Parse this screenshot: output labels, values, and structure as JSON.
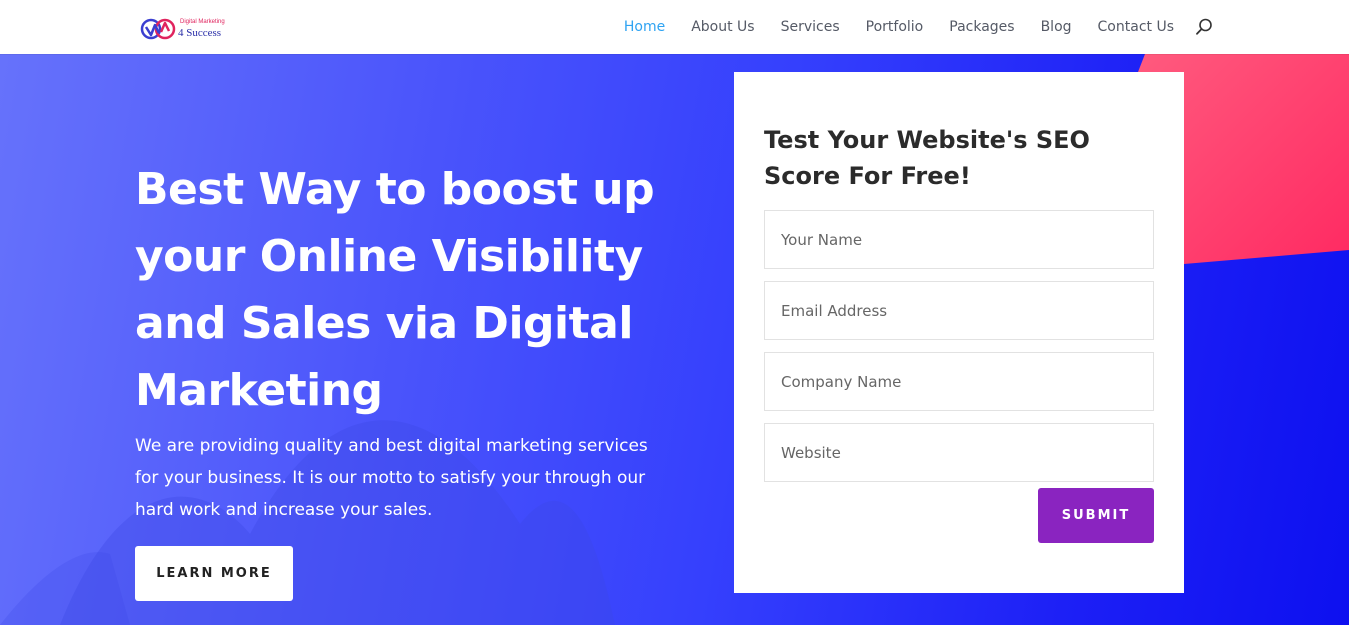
{
  "logo": {
    "tagline": "Digital Marketing",
    "name": "4 Success"
  },
  "nav": {
    "items": [
      {
        "label": "Home",
        "active": true
      },
      {
        "label": "About Us",
        "active": false
      },
      {
        "label": "Services",
        "active": false
      },
      {
        "label": "Portfolio",
        "active": false
      },
      {
        "label": "Packages",
        "active": false
      },
      {
        "label": "Blog",
        "active": false
      },
      {
        "label": "Contact Us",
        "active": false
      }
    ],
    "search_icon": "search-icon"
  },
  "hero": {
    "headline": "Best Way to boost up your Online Visibility and Sales via Digital Marketing",
    "subtext": "We are providing quality and best digital marketing services for your business. It is our motto to satisfy your through our hard work and increase your sales.",
    "cta_label": "LEARN MORE"
  },
  "form": {
    "title": "Test Your Website's SEO Score For Free!",
    "fields": [
      {
        "placeholder": "Your Name",
        "value": ""
      },
      {
        "placeholder": "Email Address",
        "value": ""
      },
      {
        "placeholder": "Company Name",
        "value": ""
      },
      {
        "placeholder": "Website",
        "value": ""
      }
    ],
    "submit_label": "SUBMIT"
  },
  "colors": {
    "nav_active": "#2ea3f2",
    "hero_gradient_start": "#6672fb",
    "hero_gradient_end": "#0d10f0",
    "accent_pink": "#ff2f6e",
    "submit_purple": "#8a24c0"
  }
}
